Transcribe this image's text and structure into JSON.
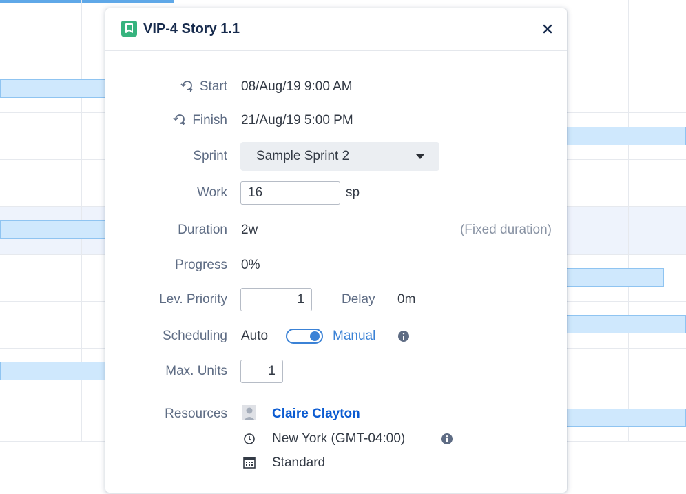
{
  "dialog": {
    "title": "VIP-4 Story 1.1",
    "close_label": "×"
  },
  "fields": {
    "start": {
      "label": "Start",
      "value": "08/Aug/19 9:00 AM"
    },
    "finish": {
      "label": "Finish",
      "value": "21/Aug/19 5:00 PM"
    },
    "sprint": {
      "label": "Sprint",
      "value": "Sample Sprint 2"
    },
    "work": {
      "label": "Work",
      "value": "16",
      "unit": "sp"
    },
    "duration": {
      "label": "Duration",
      "value": "2w",
      "note": "(Fixed duration)"
    },
    "progress": {
      "label": "Progress",
      "value": "0%"
    },
    "priority": {
      "label": "Lev. Priority",
      "value": "1",
      "delay_label": "Delay",
      "delay_value": "0m"
    },
    "scheduling": {
      "label": "Scheduling",
      "auto_label": "Auto",
      "manual_label": "Manual",
      "mode": "manual"
    },
    "max_units": {
      "label": "Max. Units",
      "value": "1"
    },
    "resources": {
      "label": "Resources",
      "name": "Claire Clayton",
      "timezone": "New York (GMT-04:00)",
      "calendar": "Standard"
    }
  },
  "icons": {
    "story": "bookmark-icon",
    "close": "close-icon",
    "date_cycle": "cycle-arrow-icon",
    "dropdown": "caret-down-icon",
    "info": "info-icon",
    "avatar": "avatar-placeholder-icon",
    "clock": "clock-icon",
    "calendar": "calendar-icon"
  },
  "colors": {
    "story_green": "#36b37e",
    "accent_blue": "#3b82d6",
    "link_blue": "#0b5bd1",
    "gantt_bar_fill": "#cfe8fd",
    "gantt_bar_border": "#8fc4f1"
  }
}
